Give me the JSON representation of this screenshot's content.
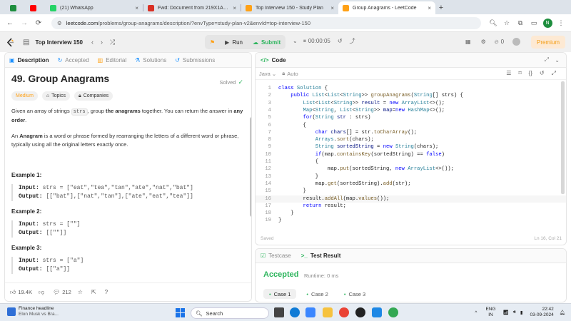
{
  "browser": {
    "tabs": [
      {
        "title": "",
        "icon": "google-drive-icon",
        "color": "#1e8e3e"
      },
      {
        "title": "",
        "icon": "youtube-icon",
        "color": "#ff0000"
      },
      {
        "title": "(21) WhatsApp",
        "icon": "whatsapp-icon",
        "color": "#25d366"
      },
      {
        "title": "Fwd: Document from 219X1A…",
        "icon": "gmail-icon",
        "color": "#d93025"
      },
      {
        "title": "Top Interview 150 - Study Plan",
        "icon": "leetcode-icon",
        "color": "#ffa116"
      },
      {
        "title": "Group Anagrams - LeetCode",
        "icon": "leetcode-icon",
        "color": "#ffa116"
      }
    ],
    "url_host": "leetcode.com",
    "url_path": "/problems/group-anagrams/description/?envType=study-plan-v2&envId=top-interview-150",
    "profile_initial": "N"
  },
  "lcnav": {
    "study_plan": "Top Interview 150",
    "run": "Run",
    "submit": "Submit",
    "timer": "00:00:05",
    "notifications": "0",
    "premium": "Premium"
  },
  "left": {
    "tabs": [
      "Description",
      "Accepted",
      "Editorial",
      "Solutions",
      "Submissions"
    ],
    "title": "49. Group Anagrams",
    "solved": "Solved",
    "chips": [
      "Medium",
      "Topics",
      "Companies"
    ],
    "desc1_a": "Given an array of strings ",
    "desc1_code": "strs",
    "desc1_b": ", group ",
    "desc1_bold": "the anagrams",
    "desc1_c": " together. You can return the answer in ",
    "desc1_bold2": "any order",
    "desc1_d": ".",
    "desc2_bold": "Anagram",
    "desc2_a": "An ",
    "desc2_b": " is a word or phrase formed by rearranging the letters of a different word or phrase, typically using all the original letters exactly once.",
    "examples": [
      {
        "head": "Example 1:",
        "input": "strs = [\"eat\",\"tea\",\"tan\",\"ate\",\"nat\",\"bat\"]",
        "output": "[[\"bat\"],[\"nat\",\"tan\"],[\"ate\",\"eat\",\"tea\"]]"
      },
      {
        "head": "Example 2:",
        "input": "strs = [\"\"]",
        "output": "[[\"\"]]"
      },
      {
        "head": "Example 3:",
        "input": "strs = [\"a\"]",
        "output": "[[\"a\"]]"
      }
    ],
    "input_label": "Input:",
    "output_label": "Output:",
    "likes": "19.4K",
    "comments": "212"
  },
  "code": {
    "header": "Code",
    "language": "Java",
    "mode": "Auto",
    "saved": "Saved",
    "cursor": "Ln 16, Col 21",
    "lines": [
      [
        [
          "kw",
          "class "
        ],
        [
          "ty",
          "Solution "
        ],
        [
          "pu",
          "{"
        ]
      ],
      [
        [
          "pu",
          "    "
        ],
        [
          "kw",
          "public "
        ],
        [
          "ty",
          "List"
        ],
        [
          "pu",
          "<"
        ],
        [
          "ty",
          "List"
        ],
        [
          "pu",
          "<"
        ],
        [
          "ty",
          "String"
        ],
        [
          "pu",
          ">> "
        ],
        [
          "fn",
          "groupAnagrams"
        ],
        [
          "pu",
          "("
        ],
        [
          "ty",
          "String"
        ],
        [
          "pu",
          "[] strs) {"
        ]
      ],
      [
        [
          "pu",
          "        "
        ],
        [
          "ty",
          "List"
        ],
        [
          "pu",
          "<"
        ],
        [
          "ty",
          "List"
        ],
        [
          "pu",
          "<"
        ],
        [
          "ty",
          "String"
        ],
        [
          "pu",
          ">> "
        ],
        [
          "vr",
          "result"
        ],
        [
          "pu",
          " = "
        ],
        [
          "kw",
          "new "
        ],
        [
          "ty",
          "ArrayList"
        ],
        [
          "pu",
          "<>();"
        ]
      ],
      [
        [
          "pu",
          "        "
        ],
        [
          "ty",
          "Map"
        ],
        [
          "pu",
          "<"
        ],
        [
          "ty",
          "String"
        ],
        [
          "pu",
          ", "
        ],
        [
          "ty",
          "List"
        ],
        [
          "pu",
          "<"
        ],
        [
          "ty",
          "String"
        ],
        [
          "pu",
          ">> "
        ],
        [
          "vr",
          "map"
        ],
        [
          "pu",
          "="
        ],
        [
          "kw",
          "new "
        ],
        [
          "ty",
          "HashMap"
        ],
        [
          "pu",
          "<>();"
        ]
      ],
      [
        [
          "pu",
          "        "
        ],
        [
          "kw",
          "for"
        ],
        [
          "pu",
          "("
        ],
        [
          "ty",
          "String "
        ],
        [
          "vr",
          "str"
        ],
        [
          "pu",
          " : strs)"
        ]
      ],
      [
        [
          "pu",
          "        {"
        ]
      ],
      [
        [
          "pu",
          "            "
        ],
        [
          "kw",
          "char "
        ],
        [
          "vr",
          "chars"
        ],
        [
          "pu",
          "[] = str."
        ],
        [
          "fn",
          "toCharArray"
        ],
        [
          "pu",
          "();"
        ]
      ],
      [
        [
          "pu",
          "            "
        ],
        [
          "ty",
          "Arrays"
        ],
        [
          "pu",
          "."
        ],
        [
          "fn",
          "sort"
        ],
        [
          "pu",
          "(chars);"
        ]
      ],
      [
        [
          "pu",
          "            "
        ],
        [
          "ty",
          "String "
        ],
        [
          "vr",
          "sortedString"
        ],
        [
          "pu",
          " = "
        ],
        [
          "kw",
          "new "
        ],
        [
          "ty",
          "String"
        ],
        [
          "pu",
          "(chars);"
        ]
      ],
      [
        [
          "pu",
          "            "
        ],
        [
          "kw",
          "if"
        ],
        [
          "pu",
          "(map."
        ],
        [
          "fn",
          "containsKey"
        ],
        [
          "pu",
          "(sortedString) == "
        ],
        [
          "kw",
          "false"
        ],
        [
          "pu",
          ")"
        ]
      ],
      [
        [
          "pu",
          "            {"
        ]
      ],
      [
        [
          "pu",
          "                map."
        ],
        [
          "fn",
          "put"
        ],
        [
          "pu",
          "(sortedString, "
        ],
        [
          "kw",
          "new "
        ],
        [
          "ty",
          "ArrayList"
        ],
        [
          "pu",
          "<>());"
        ]
      ],
      [
        [
          "pu",
          "            }"
        ]
      ],
      [
        [
          "pu",
          "            map."
        ],
        [
          "fn",
          "get"
        ],
        [
          "pu",
          "(sortedString)."
        ],
        [
          "fn",
          "add"
        ],
        [
          "pu",
          "(str);"
        ]
      ],
      [
        [
          "pu",
          "        }"
        ]
      ],
      [
        [
          "pu",
          "        result."
        ],
        [
          "fn",
          "addAll"
        ],
        [
          "pu",
          "(map."
        ],
        [
          "fn",
          "values"
        ],
        [
          "pu",
          "());"
        ]
      ],
      [
        [
          "pu",
          "        "
        ],
        [
          "kw",
          "return "
        ],
        [
          "pu",
          "result;"
        ]
      ],
      [
        [
          "pu",
          "    }"
        ]
      ],
      [
        [
          "pu",
          "}"
        ]
      ]
    ]
  },
  "test": {
    "tab1": "Testcase",
    "tab2": "Test Result",
    "status": "Accepted",
    "runtime": "Runtime: 0 ms",
    "cases": [
      "Case 1",
      "Case 2",
      "Case 3"
    ]
  },
  "taskbar": {
    "news_title": "Finance headline",
    "news_sub": "Elon Musk vs Bra...",
    "search": "Search",
    "lang": "ENG",
    "region": "IN",
    "time": "22:42",
    "date": "03-09-2024"
  }
}
